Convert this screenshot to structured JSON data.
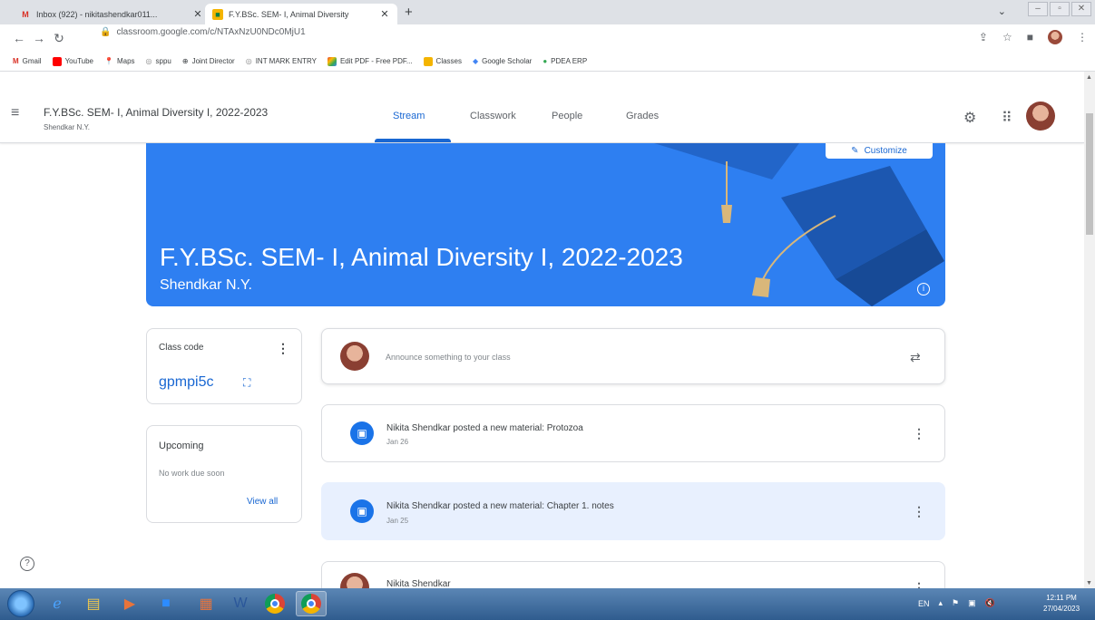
{
  "browser": {
    "tabs": [
      {
        "title": "Inbox (922) - nikitashendkar011...",
        "active": false
      },
      {
        "title": "F.Y.BSc. SEM- I, Animal Diversity",
        "active": true
      }
    ],
    "url": "classroom.google.com/c/NTAxNzU0NDc0MjU1",
    "bookmarks": [
      "Gmail",
      "YouTube",
      "Maps",
      "sppu",
      "Joint Director",
      "INT MARK ENTRY",
      "Edit PDF - Free PDF...",
      "Classes",
      "Google Scholar",
      "PDEA ERP"
    ]
  },
  "header": {
    "title": "F.Y.BSc. SEM- I, Animal Diversity I, 2022-2023",
    "subtitle": "Shendkar N.Y.",
    "tabs": [
      "Stream",
      "Classwork",
      "People",
      "Grades"
    ]
  },
  "banner": {
    "title": "F.Y.BSc. SEM- I, Animal Diversity I, 2022-2023",
    "subtitle": "Shendkar N.Y.",
    "customize_label": "Customize",
    "color": "#2e7ff1"
  },
  "class_code": {
    "label": "Class code",
    "value": "gpmpi5c"
  },
  "upcoming": {
    "label": "Upcoming",
    "empty_text": "No work due soon",
    "view_all": "View all"
  },
  "announce": {
    "placeholder": "Announce something to your class"
  },
  "posts": [
    {
      "title": "Nikita Shendkar posted a new material: Protozoa",
      "date": "Jan 26"
    },
    {
      "title": "Nikita Shendkar posted a new material: Chapter 1. notes",
      "date": "Jan 25"
    },
    {
      "title": "Nikita Shendkar",
      "date": ""
    }
  ],
  "taskbar": {
    "language": "EN",
    "time": "12:11 PM",
    "date": "27/04/2023"
  },
  "colors": {
    "accent": "#1967d2",
    "banner": "#2e7ff1",
    "highlight": "#e8f0fe"
  }
}
